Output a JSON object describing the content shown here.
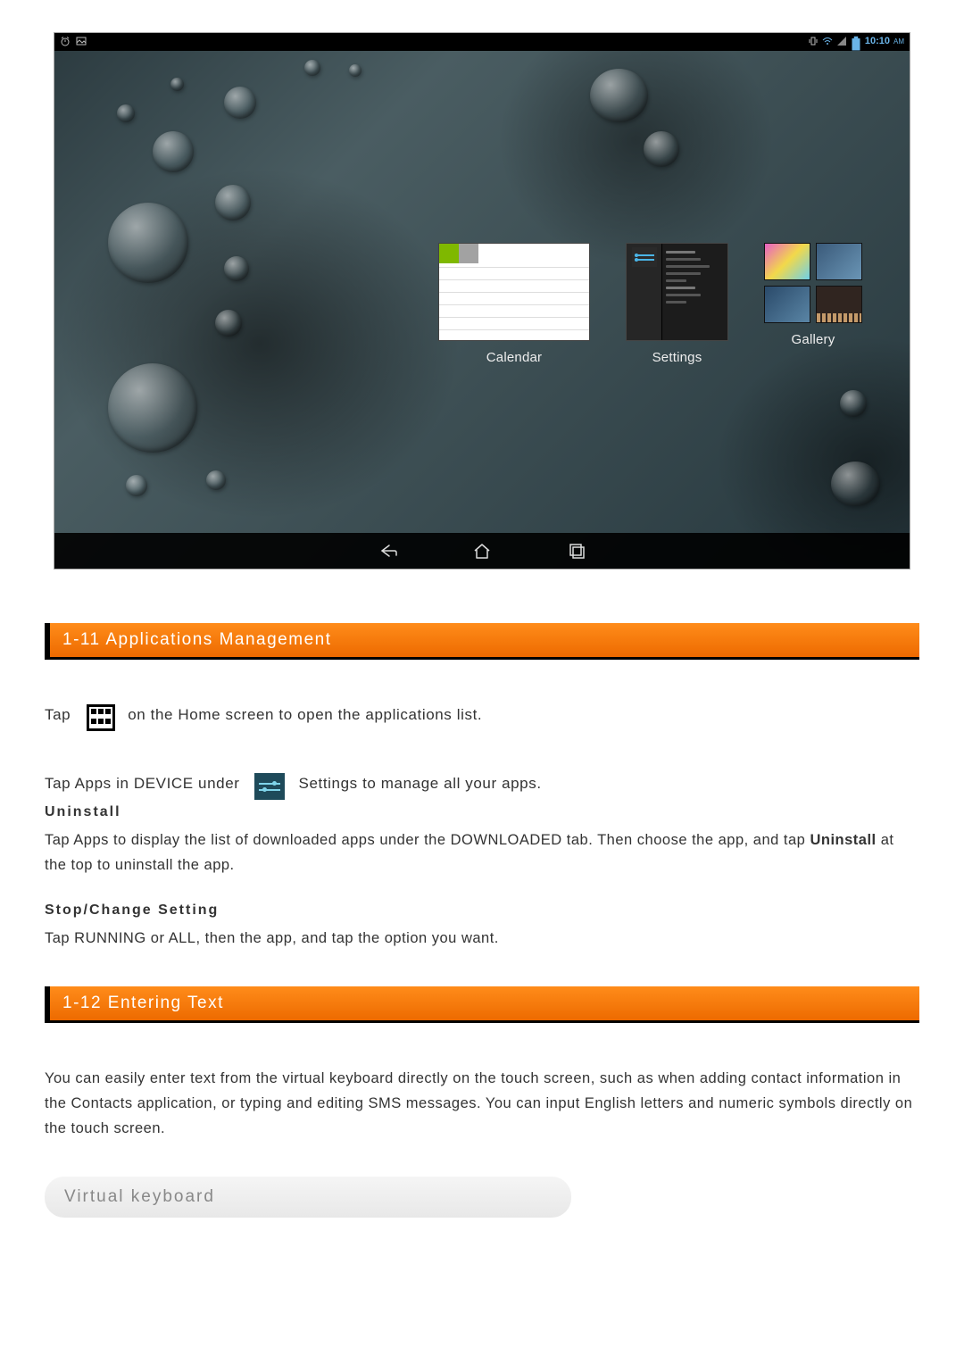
{
  "screenshot": {
    "status_time": "10:10",
    "status_am": "AM",
    "widgets": {
      "calendar": {
        "label": "Calendar"
      },
      "settings": {
        "label": "Settings"
      },
      "gallery": {
        "label": "Gallery"
      }
    }
  },
  "section_1_11": {
    "title": "1-11 Applications Management",
    "line1_a": "Tap",
    "line1_b": "on the Home screen to open the applications list.",
    "line2_a": "Tap Apps in DEVICE under",
    "line2_b": "Settings to manage all your apps.",
    "uninstall_head": "Uninstall",
    "uninstall_body_a": "Tap Apps to display the list of downloaded apps under the DOWNLOADED tab. Then choose the app, and tap ",
    "uninstall_body_strong": "Uninstall",
    "uninstall_body_b": " at the top to uninstall the app.",
    "stop_head": "Stop/Change Setting",
    "stop_body": "Tap RUNNING or ALL, then the app, and tap the option you want."
  },
  "section_1_12": {
    "title": "1-12 Entering Text",
    "body": "You can easily enter text from the virtual keyboard directly on the touch screen, such as when adding contact information in the Contacts application, or typing and editing SMS messages. You can input English letters and numeric symbols directly on the touch screen.",
    "virtual_kb": "Virtual keyboard"
  }
}
